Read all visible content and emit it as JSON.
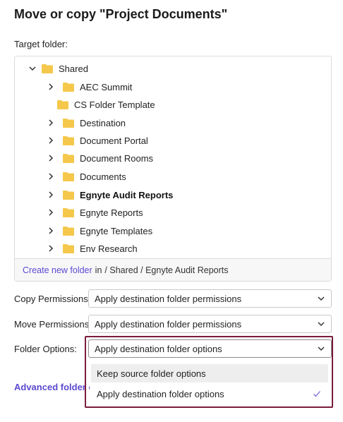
{
  "dialog": {
    "title": "Move or copy \"Project Documents\""
  },
  "target": {
    "label": "Target folder:"
  },
  "tree": {
    "root": "Shared",
    "items": [
      {
        "label": "AEC Summit"
      },
      {
        "label": "CS Folder Template"
      },
      {
        "label": "Destination"
      },
      {
        "label": "Document Portal"
      },
      {
        "label": "Document Rooms"
      },
      {
        "label": "Documents"
      },
      {
        "label": "Egnyte Audit Reports"
      },
      {
        "label": "Egnyte Reports"
      },
      {
        "label": "Egnyte Templates"
      },
      {
        "label": "Env Research"
      }
    ]
  },
  "footer": {
    "create_link": "Create new folder",
    "in_text": "in",
    "path": "/ Shared / Egnyte Audit Reports"
  },
  "copy_permissions": {
    "label": "Copy Permissions:",
    "value": "Apply destination folder permissions"
  },
  "move_permissions": {
    "label": "Move Permissions:",
    "value": "Apply destination folder permissions"
  },
  "folder_options": {
    "label": "Folder Options:",
    "value": "Apply destination folder options",
    "options": [
      "Keep source folder options",
      "Apply destination folder options"
    ]
  },
  "advanced": {
    "label": "Advanced folder c"
  },
  "colors": {
    "accent": "#5b4ad1",
    "folder": "#f5c84c",
    "highlight": "#7a1d3c"
  }
}
